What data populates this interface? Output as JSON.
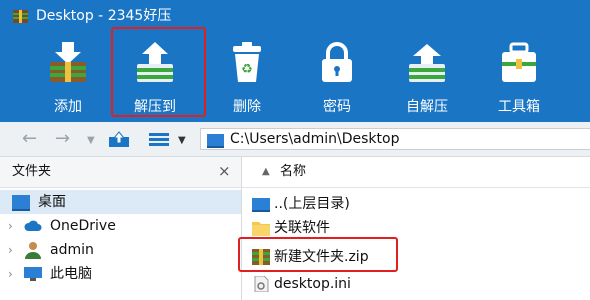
{
  "window": {
    "title": "Desktop - 2345好压"
  },
  "toolbar": {
    "add_label": "添加",
    "extract_label": "解压到",
    "delete_label": "删除",
    "password_label": "密码",
    "self_extract_label": "自解压",
    "toolbox_label": "工具箱"
  },
  "nav": {
    "address": "C:\\Users\\admin\\Desktop"
  },
  "folder_pane": {
    "title": "文件夹",
    "close": "×",
    "items": [
      {
        "label": "桌面"
      },
      {
        "label": "OneDrive"
      },
      {
        "label": "admin"
      },
      {
        "label": "此电脑"
      }
    ]
  },
  "file_list": {
    "column_name": "名称",
    "items": [
      {
        "name": "..(上层目录)"
      },
      {
        "name": "关联软件"
      },
      {
        "name": "新建文件夹.zip"
      },
      {
        "name": "desktop.ini"
      }
    ]
  },
  "colors": {
    "accent": "#1a76c4",
    "highlight": "#e02020"
  }
}
